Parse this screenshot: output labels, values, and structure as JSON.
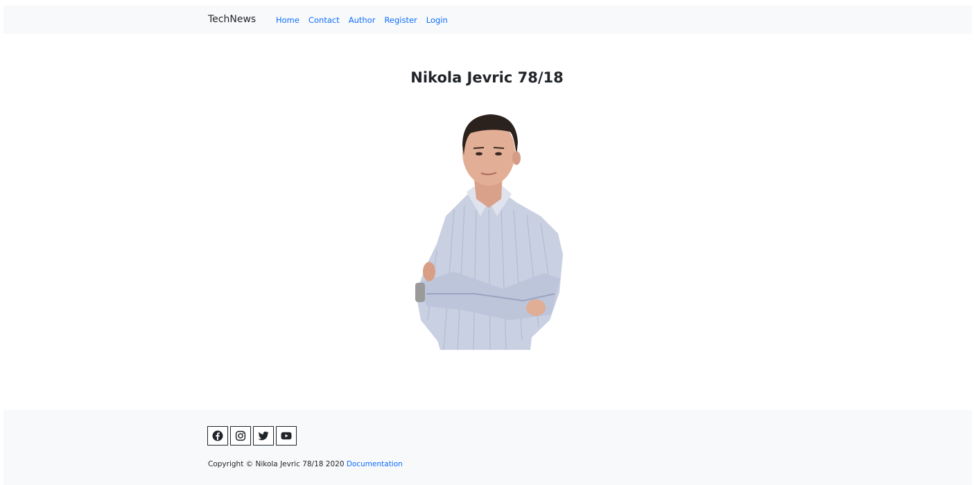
{
  "navbar": {
    "brand": "TechNews",
    "links": [
      {
        "label": "Home"
      },
      {
        "label": "Contact"
      },
      {
        "label": "Author"
      },
      {
        "label": "Register"
      },
      {
        "label": "Login"
      }
    ]
  },
  "main": {
    "title": "Nikola Jevric 78/18"
  },
  "footer": {
    "socials": [
      {
        "icon": "facebook-icon"
      },
      {
        "icon": "instagram-icon"
      },
      {
        "icon": "twitter-icon"
      },
      {
        "icon": "youtube-icon"
      }
    ],
    "copyright": "Copyright © Nikola Jevric 78/18 2020",
    "documentation_link": "Documentation"
  },
  "colors": {
    "link": "#0d6efd",
    "navbar_bg": "#f8f9fa",
    "text": "#212529"
  }
}
